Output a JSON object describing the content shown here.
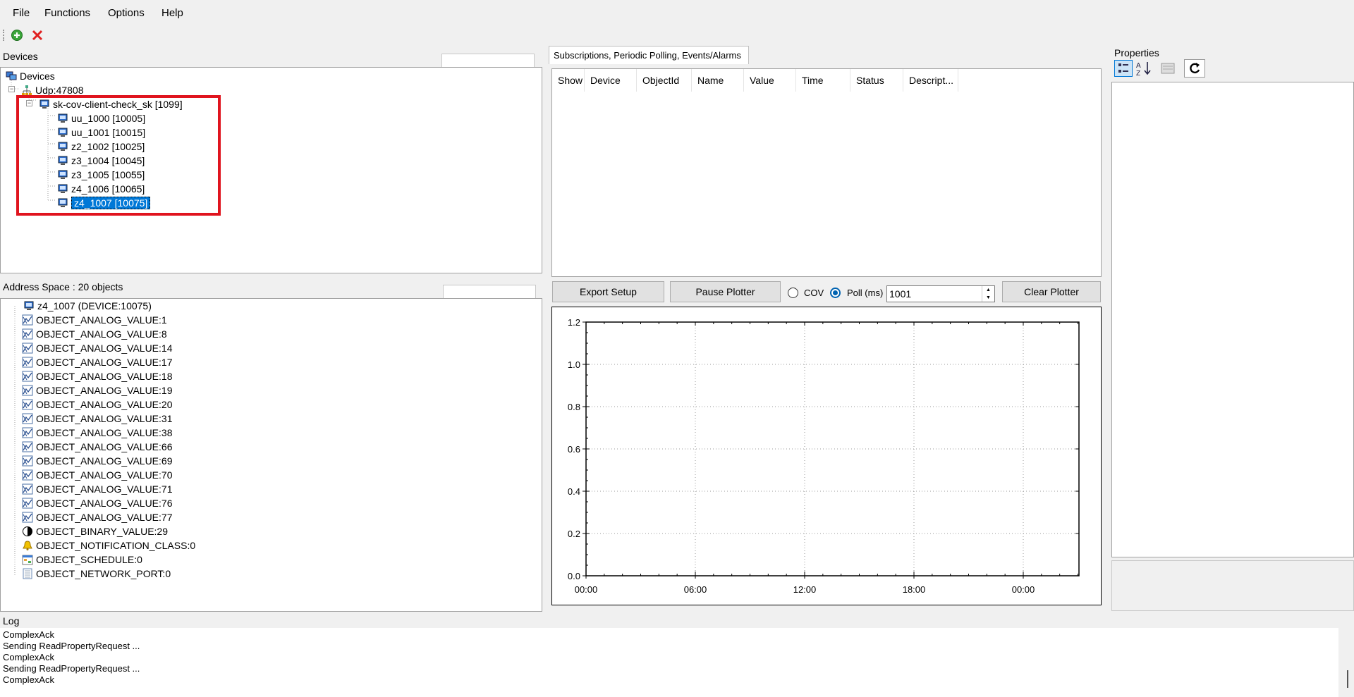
{
  "menu": [
    "File",
    "Functions",
    "Options",
    "Help"
  ],
  "devices": {
    "label": "Devices",
    "root": "Devices",
    "network": "Udp:47808",
    "client": "sk-cov-client-check_sk [1099]",
    "items": [
      "uu_1000 [10005]",
      "uu_1001 [10015]",
      "z2_1002 [10025]",
      "z3_1004 [10045]",
      "z3_1005 [10055]",
      "z4_1006 [10065]",
      "z4_1007 [10075]"
    ]
  },
  "address_space": {
    "label": "Address Space : 20 objects",
    "device": "z4_1007 (DEVICE:10075)",
    "objects": [
      {
        "name": "OBJECT_ANALOG_VALUE:1",
        "icon": "analog-icon"
      },
      {
        "name": "OBJECT_ANALOG_VALUE:8",
        "icon": "analog-icon"
      },
      {
        "name": "OBJECT_ANALOG_VALUE:14",
        "icon": "analog-icon"
      },
      {
        "name": "OBJECT_ANALOG_VALUE:17",
        "icon": "analog-icon"
      },
      {
        "name": "OBJECT_ANALOG_VALUE:18",
        "icon": "analog-icon"
      },
      {
        "name": "OBJECT_ANALOG_VALUE:19",
        "icon": "analog-icon"
      },
      {
        "name": "OBJECT_ANALOG_VALUE:20",
        "icon": "analog-icon"
      },
      {
        "name": "OBJECT_ANALOG_VALUE:31",
        "icon": "analog-icon"
      },
      {
        "name": "OBJECT_ANALOG_VALUE:38",
        "icon": "analog-icon"
      },
      {
        "name": "OBJECT_ANALOG_VALUE:66",
        "icon": "analog-icon"
      },
      {
        "name": "OBJECT_ANALOG_VALUE:69",
        "icon": "analog-icon"
      },
      {
        "name": "OBJECT_ANALOG_VALUE:70",
        "icon": "analog-icon"
      },
      {
        "name": "OBJECT_ANALOG_VALUE:71",
        "icon": "analog-icon"
      },
      {
        "name": "OBJECT_ANALOG_VALUE:76",
        "icon": "analog-icon"
      },
      {
        "name": "OBJECT_ANALOG_VALUE:77",
        "icon": "analog-icon"
      },
      {
        "name": "OBJECT_BINARY_VALUE:29",
        "icon": "binary-icon"
      },
      {
        "name": "OBJECT_NOTIFICATION_CLASS:0",
        "icon": "bell-icon"
      },
      {
        "name": "OBJECT_SCHEDULE:0",
        "icon": "schedule-icon"
      },
      {
        "name": "OBJECT_NETWORK_PORT:0",
        "icon": "network-port-icon"
      }
    ]
  },
  "subscriptions": {
    "tab": "Subscriptions, Periodic Polling, Events/Alarms",
    "columns": [
      "Show",
      "Device",
      "ObjectId",
      "Name",
      "Value",
      "Time",
      "Status",
      "Descript..."
    ]
  },
  "plotter": {
    "export_label": "Export Setup",
    "pause_label": "Pause Plotter",
    "cov_label": "COV",
    "poll_label": "Poll (ms)",
    "poll_value": "1001",
    "clear_label": "Clear Plotter",
    "mode_selected": "poll"
  },
  "chart_data": {
    "type": "line",
    "series": [],
    "x_ticks": [
      "00:00",
      "06:00",
      "12:00",
      "18:00",
      "00:00"
    ],
    "y_ticks": [
      "0.0",
      "0.2",
      "0.4",
      "0.6",
      "0.8",
      "1.0",
      "1.2"
    ],
    "ylim": [
      0,
      1.2
    ],
    "grid": true
  },
  "properties": {
    "label": "Properties"
  },
  "log": {
    "label": "Log",
    "lines": [
      "ComplexAck",
      "Sending ReadPropertyRequest ...",
      "ComplexAck",
      "Sending ReadPropertyRequest ...",
      "ComplexAck"
    ]
  },
  "colors": {
    "selection": "#0078d7",
    "highlight_border": "#e0141e",
    "accent": "#0063b1"
  }
}
